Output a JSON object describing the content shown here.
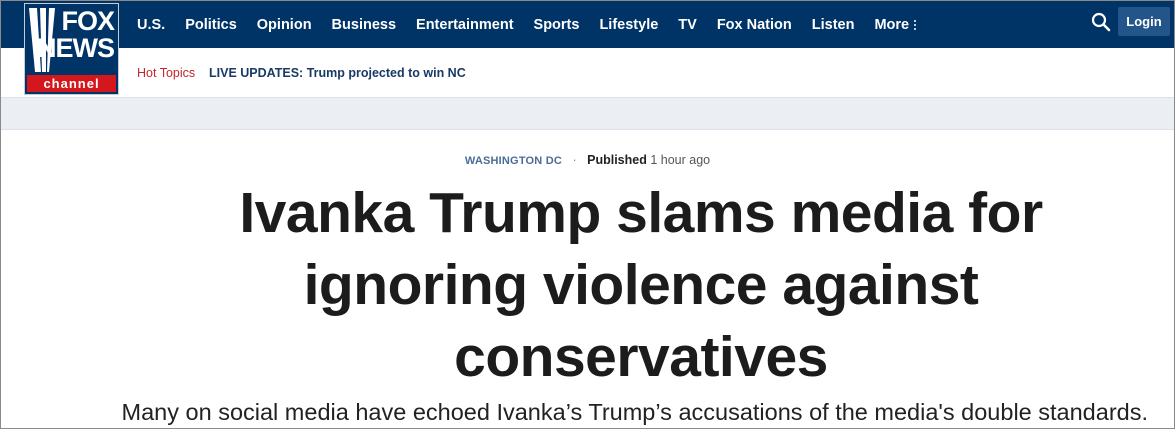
{
  "brand": {
    "logo_line1": "FOX",
    "logo_line2": "NEWS",
    "logo_line3": "channel",
    "colors": {
      "nav_bg": "#003366",
      "accent_red": "#c1272d",
      "login_bg": "#24558a"
    }
  },
  "nav": {
    "items": [
      "U.S.",
      "Politics",
      "Opinion",
      "Business",
      "Entertainment",
      "Sports",
      "Lifestyle",
      "TV",
      "Fox Nation",
      "Listen"
    ],
    "more_label": "More",
    "search_icon": "search-icon",
    "login_label": "Login"
  },
  "hot_topics": {
    "label": "Hot Topics",
    "link": "LIVE UPDATES: Trump projected to win NC"
  },
  "article": {
    "category": "WASHINGTON DC",
    "separator": "·",
    "published_label": "Published",
    "published_time": "1 hour ago",
    "headline": "Ivanka Trump slams media for ignoring violence against conservatives",
    "subheadline": "Many on social media have echoed Ivanka’s Trump’s accusations of the media's double standards."
  }
}
